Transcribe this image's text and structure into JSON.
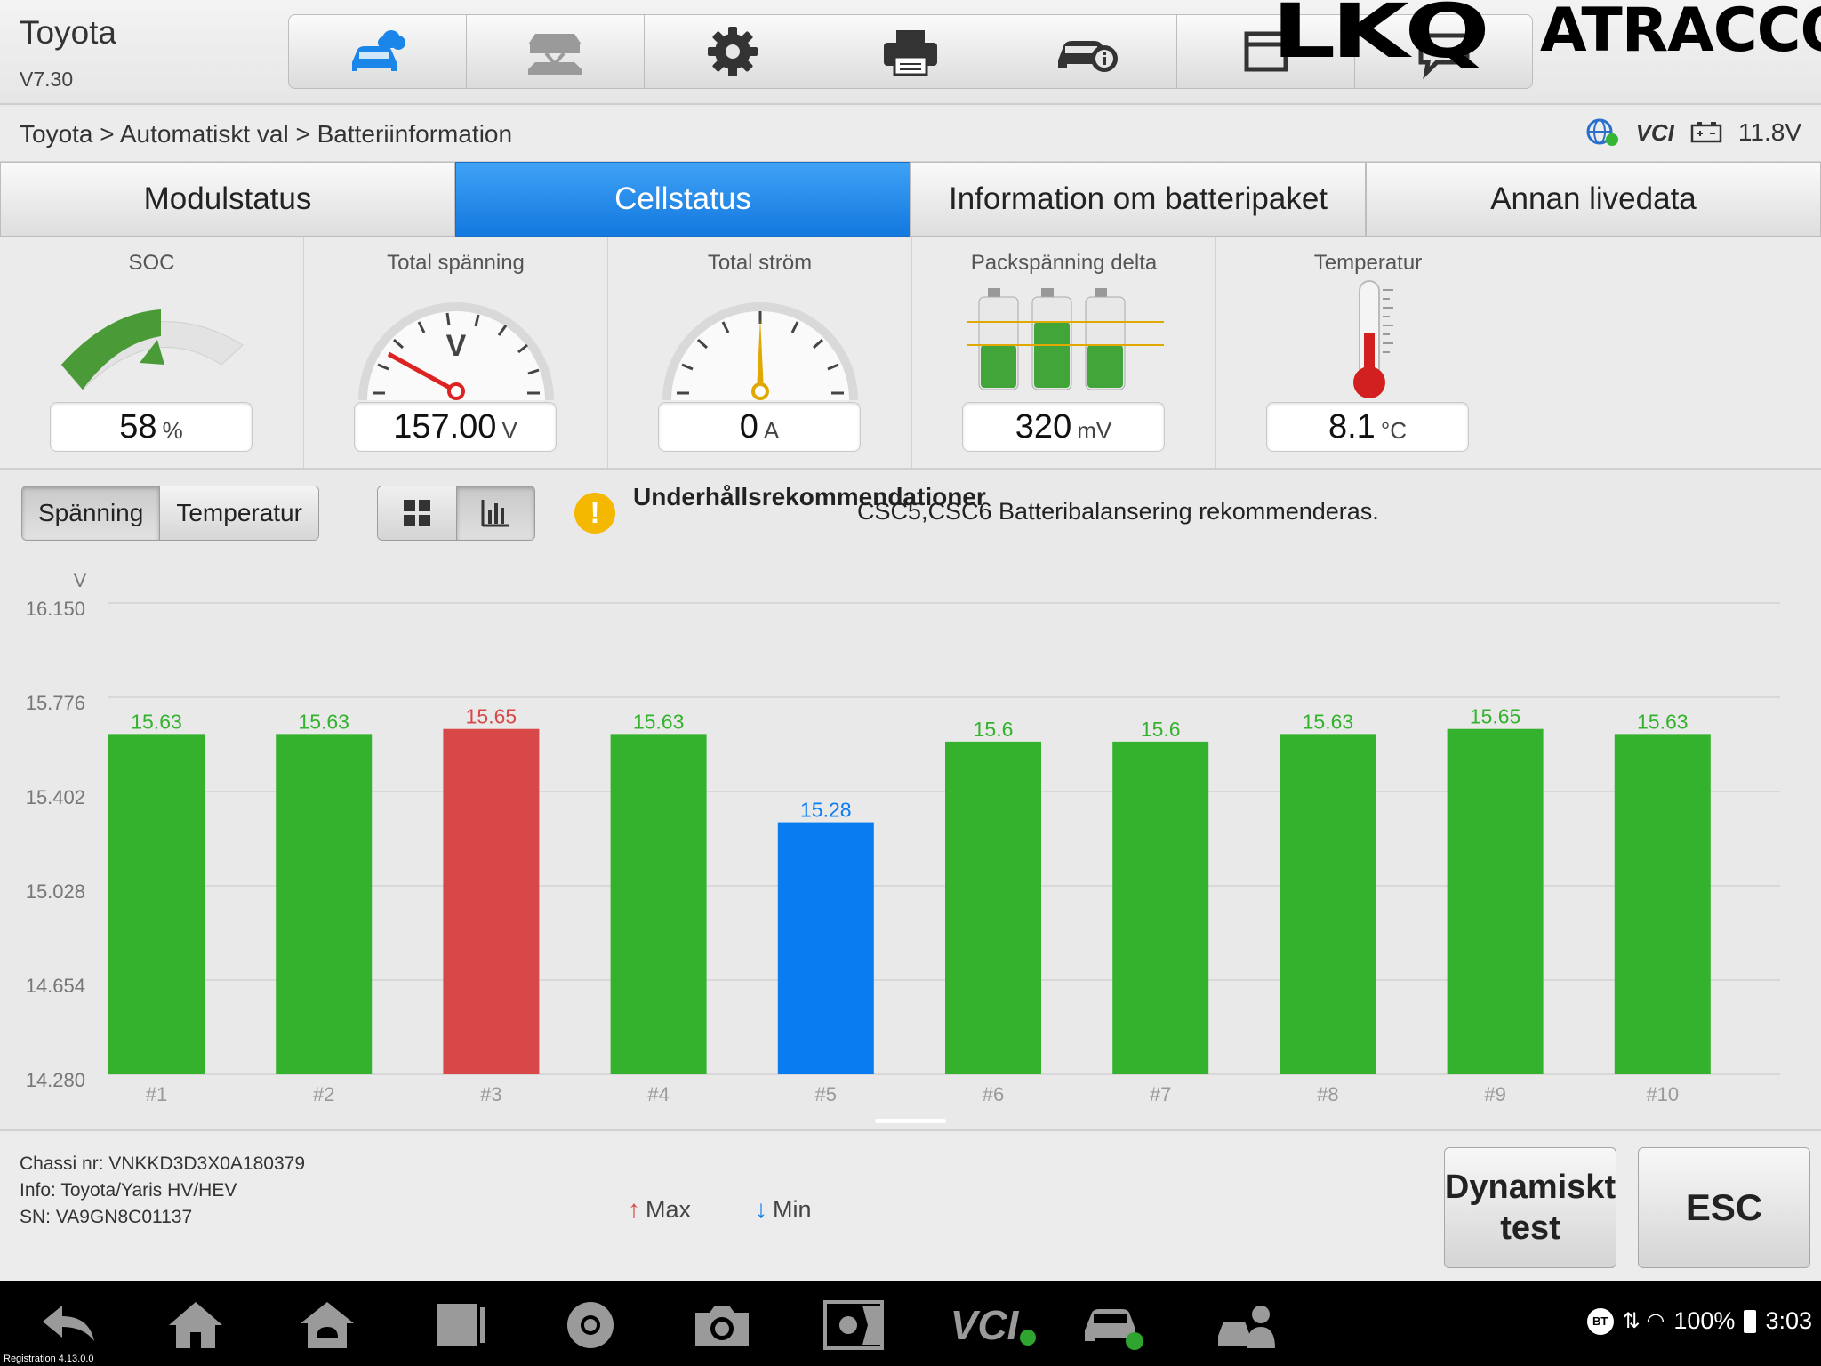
{
  "app": {
    "title": "Toyota",
    "version": "V7.30"
  },
  "brand": {
    "logo_left": "LKQ",
    "logo_right": "ATRACCO"
  },
  "toolbar": {
    "icons": [
      "vehicle-cloud-icon",
      "car-lift-icon",
      "gear-icon",
      "printer-icon",
      "car-info-icon",
      "window-icon",
      "chat-icon"
    ]
  },
  "breadcrumb": "Toyota > Automatiskt val > Batteriinformation",
  "status": {
    "vci": "VCI",
    "battery_voltage": "11.8V"
  },
  "tabs": [
    {
      "label": "Modulstatus",
      "active": false
    },
    {
      "label": "Cellstatus",
      "active": true
    },
    {
      "label": "Information om batteripaket",
      "active": false
    },
    {
      "label": "Annan livedata",
      "active": false
    }
  ],
  "gauges": {
    "soc": {
      "title": "SOC",
      "value": "58",
      "unit": "%",
      "fraction": 0.58
    },
    "voltage": {
      "title": "Total spänning",
      "value": "157.00",
      "unit": "V",
      "dial_letter": "V"
    },
    "current": {
      "title": "Total ström",
      "value": "0",
      "unit": "A"
    },
    "delta": {
      "title": "Packspänning delta",
      "value": "320",
      "unit": "mV"
    },
    "temperature": {
      "title": "Temperatur",
      "value": "8.1",
      "unit": "°C"
    }
  },
  "controls": {
    "metric_tabs": [
      {
        "label": "Spänning",
        "active": true
      },
      {
        "label": "Temperatur",
        "active": false
      }
    ],
    "view_toggle": [
      "grid-icon",
      "bar-chart-icon"
    ],
    "recommendation_label": "Underhållsrekommendationer",
    "recommendation_text": "CSC5,CSC6 Batteribalansering rekommenderas."
  },
  "chart_data": {
    "type": "bar",
    "ylabel": "V",
    "ylim": [
      14.28,
      16.15
    ],
    "yticks": [
      "16.150",
      "15.776",
      "15.402",
      "15.028",
      "14.654",
      "14.280"
    ],
    "grid": true,
    "categories": [
      "#1",
      "#2",
      "#3",
      "#4",
      "#5",
      "#6",
      "#7",
      "#8",
      "#9",
      "#10"
    ],
    "values": [
      15.63,
      15.63,
      15.65,
      15.63,
      15.28,
      15.6,
      15.6,
      15.63,
      15.65,
      15.63
    ],
    "value_labels": [
      "15.63",
      "15.63",
      "15.65",
      "15.63",
      "15.28",
      "15.6",
      "15.6",
      "15.63",
      "15.65",
      "15.63"
    ],
    "status": [
      "normal",
      "normal",
      "max",
      "normal",
      "min",
      "normal",
      "normal",
      "normal",
      "normal",
      "normal"
    ],
    "colors": {
      "normal": "#34b22e",
      "max": "#d94848",
      "min": "#0a7cf2",
      "normal_label": "#34b22e",
      "max_label": "#d94848",
      "min_label": "#0a7cf2"
    }
  },
  "footer": {
    "chassis": "Chassi nr: VNKKD3D3X0A180379",
    "info": "Info: Toyota/Yaris HV/HEV",
    "sn": "SN: VA9GN8C01137",
    "legend_max": "Max",
    "legend_min": "Min",
    "dynamic_test_label": "Dynamiskt test",
    "esc_label": "ESC"
  },
  "system": {
    "bt": "BT",
    "battery": "100%",
    "time": "3:03",
    "registration": "Registration 4.13.0.0",
    "nav_vci": "VCI"
  },
  "colors": {
    "accent_tab": "#1a86ea",
    "warning": "#f5b800"
  }
}
